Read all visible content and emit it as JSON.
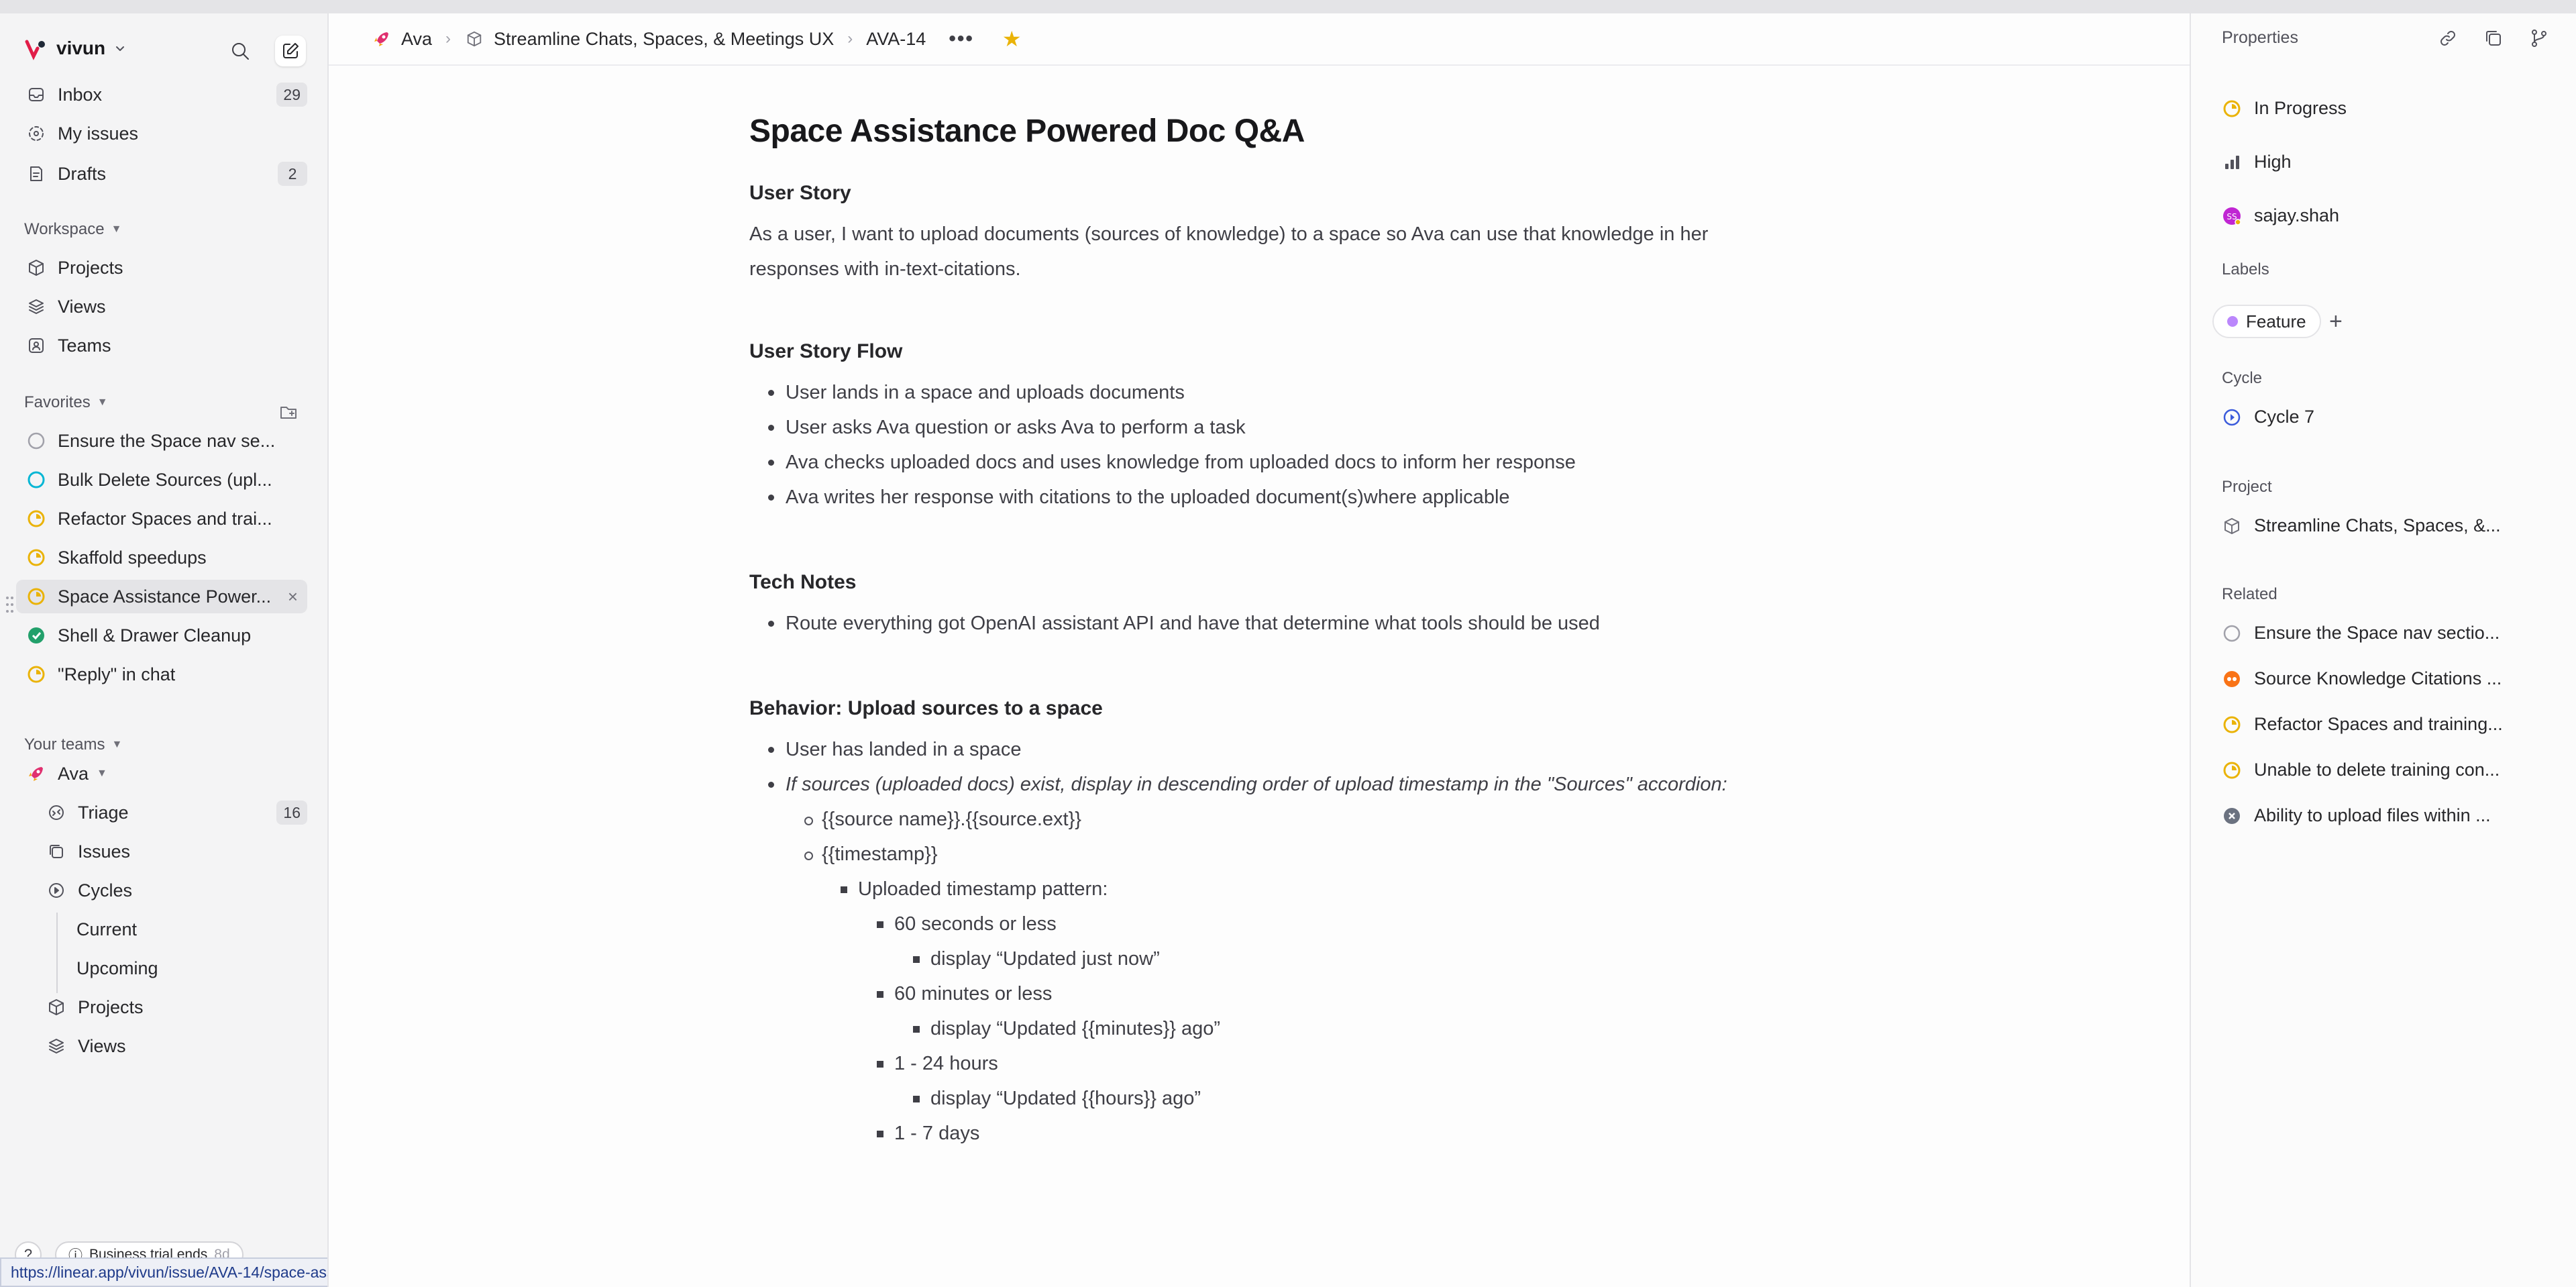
{
  "workspace": {
    "name": "vivun"
  },
  "sidebar": {
    "primary": [
      {
        "label": "Inbox",
        "count": "29"
      },
      {
        "label": "My issues"
      },
      {
        "label": "Drafts",
        "count": "2"
      }
    ],
    "workspace_header": "Workspace",
    "workspace_items": [
      {
        "label": "Projects"
      },
      {
        "label": "Views"
      },
      {
        "label": "Teams"
      }
    ],
    "favorites_header": "Favorites",
    "favorites": [
      {
        "label": "Ensure the Space nav se...",
        "status": "todo"
      },
      {
        "label": "Bulk Delete Sources (upl...",
        "status": "todo-blue"
      },
      {
        "label": "Refactor Spaces and trai...",
        "status": "in-progress"
      },
      {
        "label": "Skaffold speedups",
        "status": "in-progress"
      },
      {
        "label": "Space Assistance Power...",
        "status": "in-progress"
      },
      {
        "label": "Shell & Drawer Cleanup",
        "status": "done"
      },
      {
        "label": "\"Reply\" in chat",
        "status": "in-progress"
      }
    ],
    "teams_header": "Your teams",
    "team": {
      "name": "Ava"
    },
    "team_items": [
      {
        "label": "Triage",
        "count": "16"
      },
      {
        "label": "Issues"
      },
      {
        "label": "Cycles"
      },
      {
        "label": "Current"
      },
      {
        "label": "Upcoming"
      },
      {
        "label": "Projects"
      },
      {
        "label": "Views"
      }
    ],
    "help": "?",
    "trial_text": "Business trial ends",
    "trial_days": "8d"
  },
  "status_url": "https://linear.app/vivun/issue/AVA-14/space-assistance-powered-doc-qanda",
  "breadcrumb": {
    "team": "Ava",
    "project": "Streamline Chats, Spaces, & Meetings UX",
    "issue": "AVA-14",
    "more": "•••",
    "star": "★"
  },
  "doc": {
    "title": "Space Assistance Powered Doc Q&A",
    "story_h": "User Story",
    "story_p": "As a user, I want to upload documents (sources of knowledge) to a space so Ava can use that knowledge in her responses with in-text-citations.",
    "flow_h": "User Story Flow",
    "flow": [
      "User lands in a space and uploads documents",
      "User asks Ava question or asks Ava to perform a task",
      "Ava checks uploaded docs and uses knowledge from uploaded docs to inform her response",
      "Ava writes her response with citations to the uploaded document(s)where applicable"
    ],
    "tech_h": "Tech Notes",
    "tech": [
      "Route everything got OpenAI assistant API and have that determine what tools should be used"
    ],
    "behavior_h": "Behavior: Upload sources to a space",
    "b1": "User has landed in a space",
    "b2": "If sources (uploaded docs) exist, display in descending order of upload timestamp in the \"Sources\" accordion:",
    "b3": "{{source name}}.{{source.ext}}",
    "b4": "{{timestamp}}",
    "b5": "Uploaded timestamp pattern:",
    "b6": "60 seconds or less",
    "b7": "display “Updated just now”",
    "b8": "60 minutes or less",
    "b9": "display “Updated {{minutes}} ago”",
    "b10": "1 - 24 hours",
    "b11": "display “Updated {{hours}} ago”",
    "b12": "1 - 7 days"
  },
  "props": {
    "title": "Properties",
    "status": "In Progress",
    "priority": "High",
    "assignee": "sajay.shah",
    "labels_h": "Labels",
    "label": "Feature",
    "add": "+",
    "cycle_h": "Cycle",
    "cycle": "Cycle 7",
    "project_h": "Project",
    "project": "Streamline Chats, Spaces, &...",
    "related_h": "Related",
    "related": [
      {
        "label": "Ensure the Space nav sectio...",
        "status": "todo"
      },
      {
        "label": "Source Knowledge Citations ...",
        "status": "blocked"
      },
      {
        "label": "Refactor Spaces and training...",
        "status": "in-progress"
      },
      {
        "label": "Unable to delete training con...",
        "status": "in-progress"
      },
      {
        "label": "Ability to upload files within ...",
        "status": "canceled"
      }
    ]
  },
  "colors": {
    "in_progress": "#eab308",
    "done": "#22a06b",
    "todo_blue": "#06b6d4",
    "blocked": "#f97316",
    "canceled": "#6b7280",
    "label_feature": "#bb87fc"
  }
}
